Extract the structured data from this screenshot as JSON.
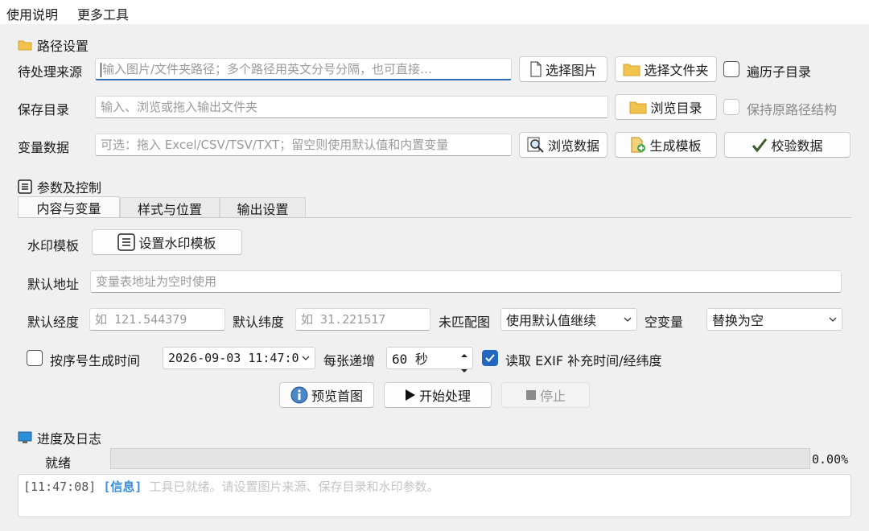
{
  "menu": {
    "help": "使用说明",
    "tools": "更多工具"
  },
  "path_section": {
    "title": "路径设置",
    "source_label": "待处理来源",
    "source_placeholder": "输入图片/文件夹路径；多个路径用英文分号分隔，也可直接…",
    "select_images": "选择图片",
    "select_folder": "选择文件夹",
    "traverse_subdirs": "遍历子目录",
    "save_label": "保存目录",
    "save_placeholder": "输入、浏览或拖入输出文件夹",
    "browse_dir": "浏览目录",
    "keep_structure": "保持原路径结构",
    "vars_label": "变量数据",
    "vars_placeholder": "可选：拖入 Excel/CSV/TSV/TXT；留空则使用默认值和内置变量",
    "browse_data": "浏览数据",
    "gen_template": "生成模板",
    "validate_data": "校验数据"
  },
  "params_section": {
    "title": "参数及控制",
    "tabs": [
      "内容与变量",
      "样式与位置",
      "输出设置"
    ],
    "watermark_label": "水印模板",
    "watermark_button": "设置水印模板",
    "address_label": "默认地址",
    "address_placeholder": "变量表地址为空时使用",
    "lon_label": "默认经度",
    "lon_placeholder": "如 121.544379",
    "lat_label": "默认纬度",
    "lat_placeholder": "如 31.221517",
    "unmatched_label": "未匹配图",
    "unmatched_value": "使用默认值继续",
    "empty_var_label": "空变量",
    "empty_var_value": "替换为空",
    "seq_time_label": "按序号生成时间",
    "datetime_value": "2026-09-03 11:47:0",
    "increment_label": "每张递增",
    "increment_value": "60 秒",
    "exif_label": "读取 EXIF 补充时间/经纬度",
    "preview_button": "预览首图",
    "start_button": "开始处理",
    "stop_button": "停止"
  },
  "progress_section": {
    "title": "进度及日志",
    "status": "就绪",
    "percent": "0.00%",
    "progress_value": 0,
    "log": [
      {
        "time": "[11:47:08]",
        "level": "[信息]",
        "message": "工具已就绪。请设置图片来源、保存目录和水印参数。"
      }
    ]
  },
  "colors": {
    "accent": "#2167c0",
    "log_level": "#3a8fd8"
  }
}
